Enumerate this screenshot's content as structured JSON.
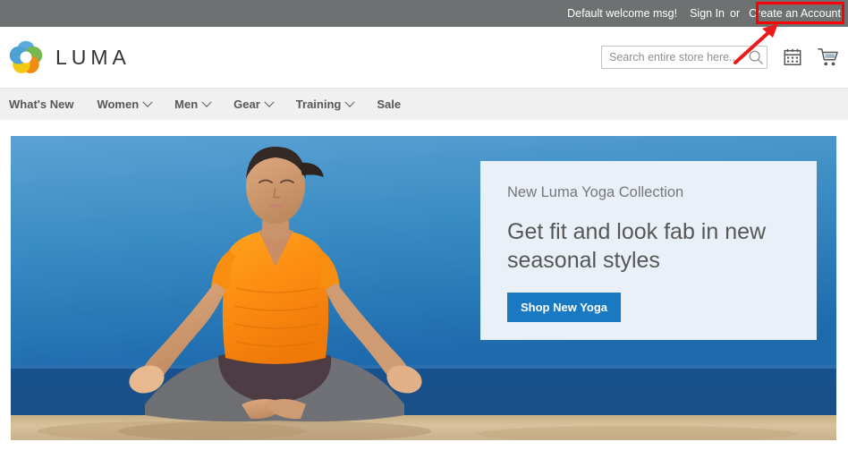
{
  "top_panel": {
    "welcome_message": "Default welcome msg!",
    "sign_in_label": "Sign In",
    "or_label": "or",
    "create_account_label": "Create an Account"
  },
  "header": {
    "logo_text": "LUMA",
    "logo_icon": "luma-flower-logo",
    "search": {
      "placeholder": "Search entire store here...",
      "value": "",
      "icon": "search-icon"
    },
    "calendar_icon": "calendar-icon",
    "cart_icon": "shopping-cart-icon"
  },
  "nav": {
    "items": [
      {
        "label": "What's New",
        "has_dropdown": false
      },
      {
        "label": "Women",
        "has_dropdown": true
      },
      {
        "label": "Men",
        "has_dropdown": true
      },
      {
        "label": "Gear",
        "has_dropdown": true
      },
      {
        "label": "Training",
        "has_dropdown": true
      },
      {
        "label": "Sale",
        "has_dropdown": false
      }
    ]
  },
  "hero": {
    "eyebrow": "New Luma Yoga Collection",
    "title": "Get fit and look fab in new seasonal styles",
    "button_label": "Shop New Yoga",
    "image_description": "Woman in orange shirt meditating in lotus pose on a sandy beach with blue sky and ocean"
  },
  "annotation": {
    "highlight_target": "Create an Account",
    "box_color": "#ff0000",
    "arrow_color": "#e81c1c"
  },
  "colors": {
    "top_panel_bg": "#6e7171",
    "nav_bg": "#f0f0f0",
    "accent_blue": "#1979c3",
    "panel_bg": "#eaf0f7",
    "text_gray": "#575757"
  }
}
